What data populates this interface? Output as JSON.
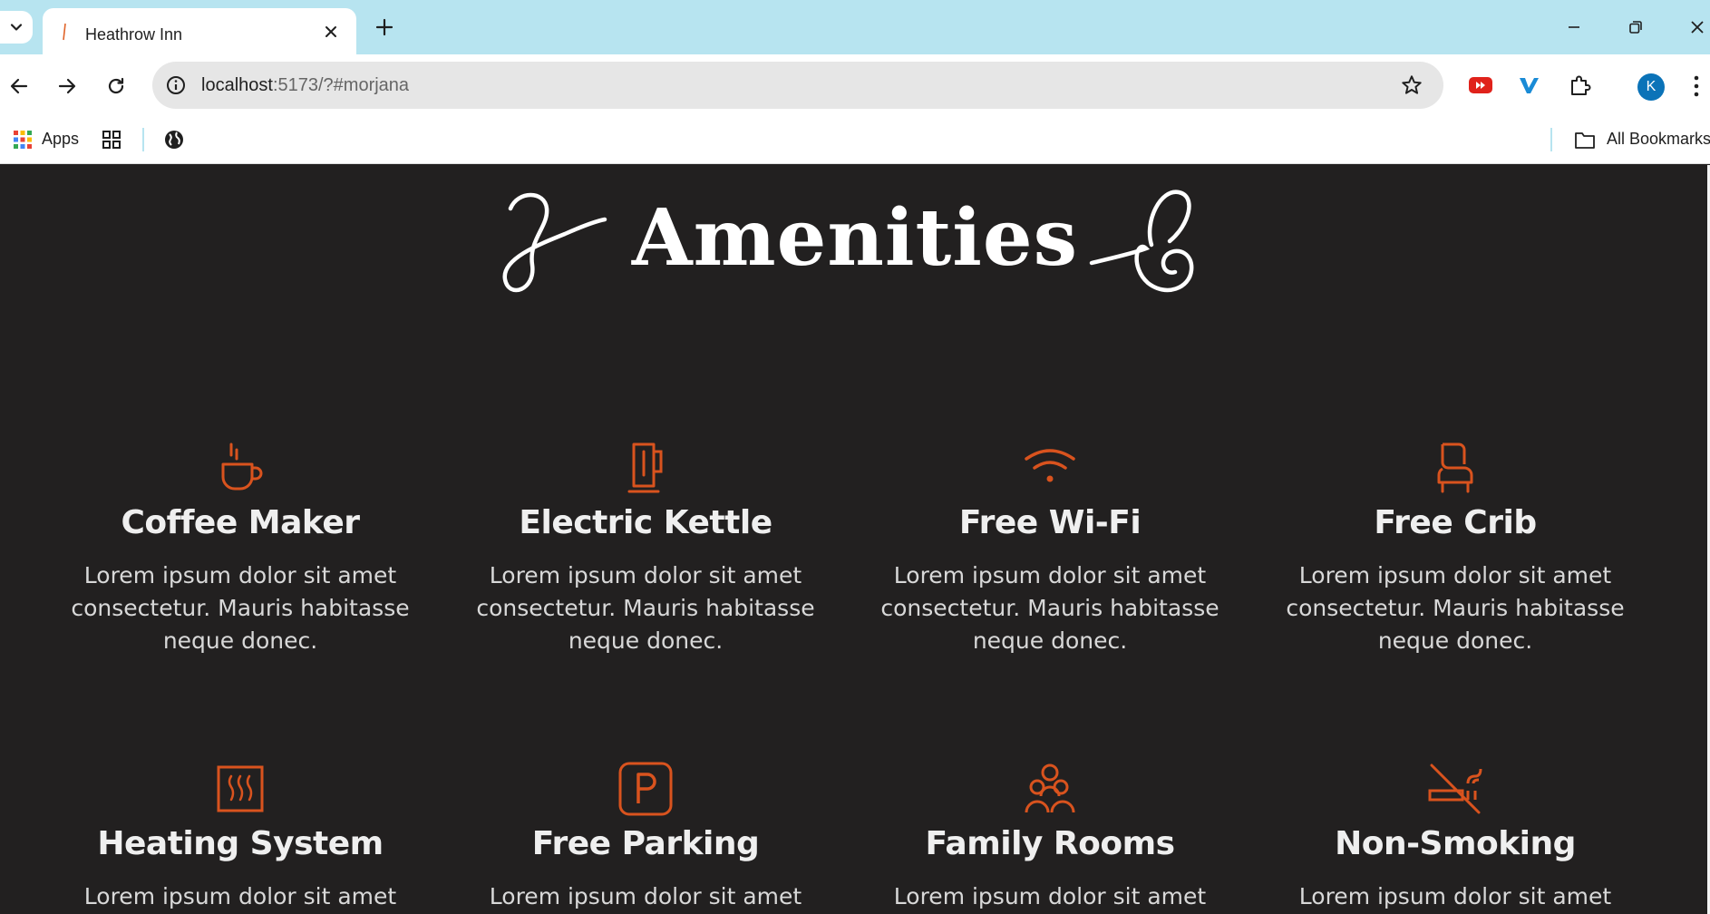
{
  "browser": {
    "tab_title": "Heathrow Inn",
    "url_host": "localhost",
    "url_rest": ":5173/?#morjana",
    "profile_initial": "K",
    "bookmarks": {
      "apps_label": "Apps",
      "all_bookmarks_label": "All Bookmarks"
    },
    "icons": [
      "tab-search-icon",
      "close-icon",
      "plus-icon",
      "minimize-icon",
      "restore-icon",
      "back-arrow-icon",
      "forward-arrow-icon",
      "reload-icon",
      "site-info-icon",
      "star-icon",
      "youtube-extension-icon",
      "vimeo-extension-icon",
      "extensions-puzzle-icon",
      "kebab-menu-icon",
      "apps-grid-icon",
      "tab-groups-icon",
      "globe-icon",
      "folder-icon"
    ]
  },
  "page": {
    "heading": "Amenities",
    "accent_color": "#d9531e",
    "background_color": "#222020",
    "amenities": [
      {
        "title": "Coffee Maker",
        "icon": "coffee-cup-icon",
        "desc_1": "Lorem ipsum dolor sit amet",
        "desc_2": "consectetur. Mauris habitasse",
        "desc_3": "neque donec."
      },
      {
        "title": "Electric Kettle",
        "icon": "kettle-icon",
        "desc_1": "Lorem ipsum dolor sit amet",
        "desc_2": "consectetur. Mauris habitasse",
        "desc_3": "neque donec."
      },
      {
        "title": "Free Wi-Fi",
        "icon": "wifi-icon",
        "desc_1": "Lorem ipsum dolor sit amet",
        "desc_2": "consectetur. Mauris habitasse",
        "desc_3": "neque donec."
      },
      {
        "title": "Free Crib",
        "icon": "crib-icon",
        "desc_1": "Lorem ipsum dolor sit amet",
        "desc_2": "consectetur. Mauris habitasse",
        "desc_3": "neque donec."
      },
      {
        "title": "Heating System",
        "icon": "heater-icon",
        "desc_1": "Lorem ipsum dolor sit amet"
      },
      {
        "title": "Free Parking",
        "icon": "parking-icon",
        "desc_1": "Lorem ipsum dolor sit amet"
      },
      {
        "title": "Family Rooms",
        "icon": "family-icon",
        "desc_1": "Lorem ipsum dolor sit amet"
      },
      {
        "title": "Non-Smoking",
        "icon": "no-smoking-icon",
        "desc_1": "Lorem ipsum dolor sit amet"
      }
    ]
  }
}
